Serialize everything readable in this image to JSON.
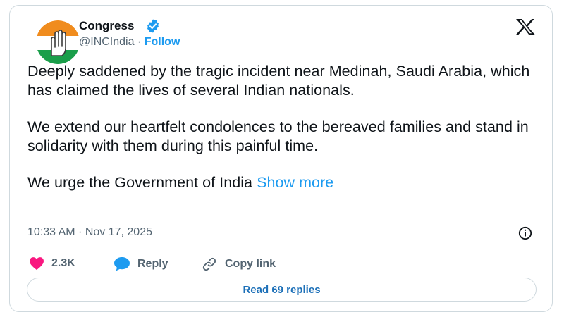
{
  "author": {
    "name": "Congress",
    "handle": "@INCIndia",
    "separator": "·",
    "follow_label": "Follow"
  },
  "tweet": {
    "paragraphs": [
      "Deeply saddened by the tragic incident near Medinah, Saudi Arabia, which has claimed the lives of several Indian nationals.",
      "We extend our heartfelt condolences to the bereaved families and stand in solidarity with them during this painful time."
    ],
    "last_paragraph": "We urge the Government of India",
    "show_more_label": "Show more",
    "timestamp": "10:33 AM · Nov 17, 2025"
  },
  "actions": {
    "like_count": "2.3K",
    "reply_label": "Reply",
    "copy_label": "Copy link"
  },
  "read_replies_label": "Read 69 replies",
  "icons": {
    "verified": "verified-badge-icon",
    "platform": "x-logo-icon",
    "info": "info-icon",
    "like": "heart-icon",
    "reply": "speech-bubble-icon",
    "copy": "link-icon"
  },
  "colors": {
    "accent": "#1d9bf0",
    "like": "#f91880",
    "muted": "#536471",
    "border": "#cfd9de",
    "saffron": "#f08c1e",
    "green": "#1a9e4a"
  }
}
